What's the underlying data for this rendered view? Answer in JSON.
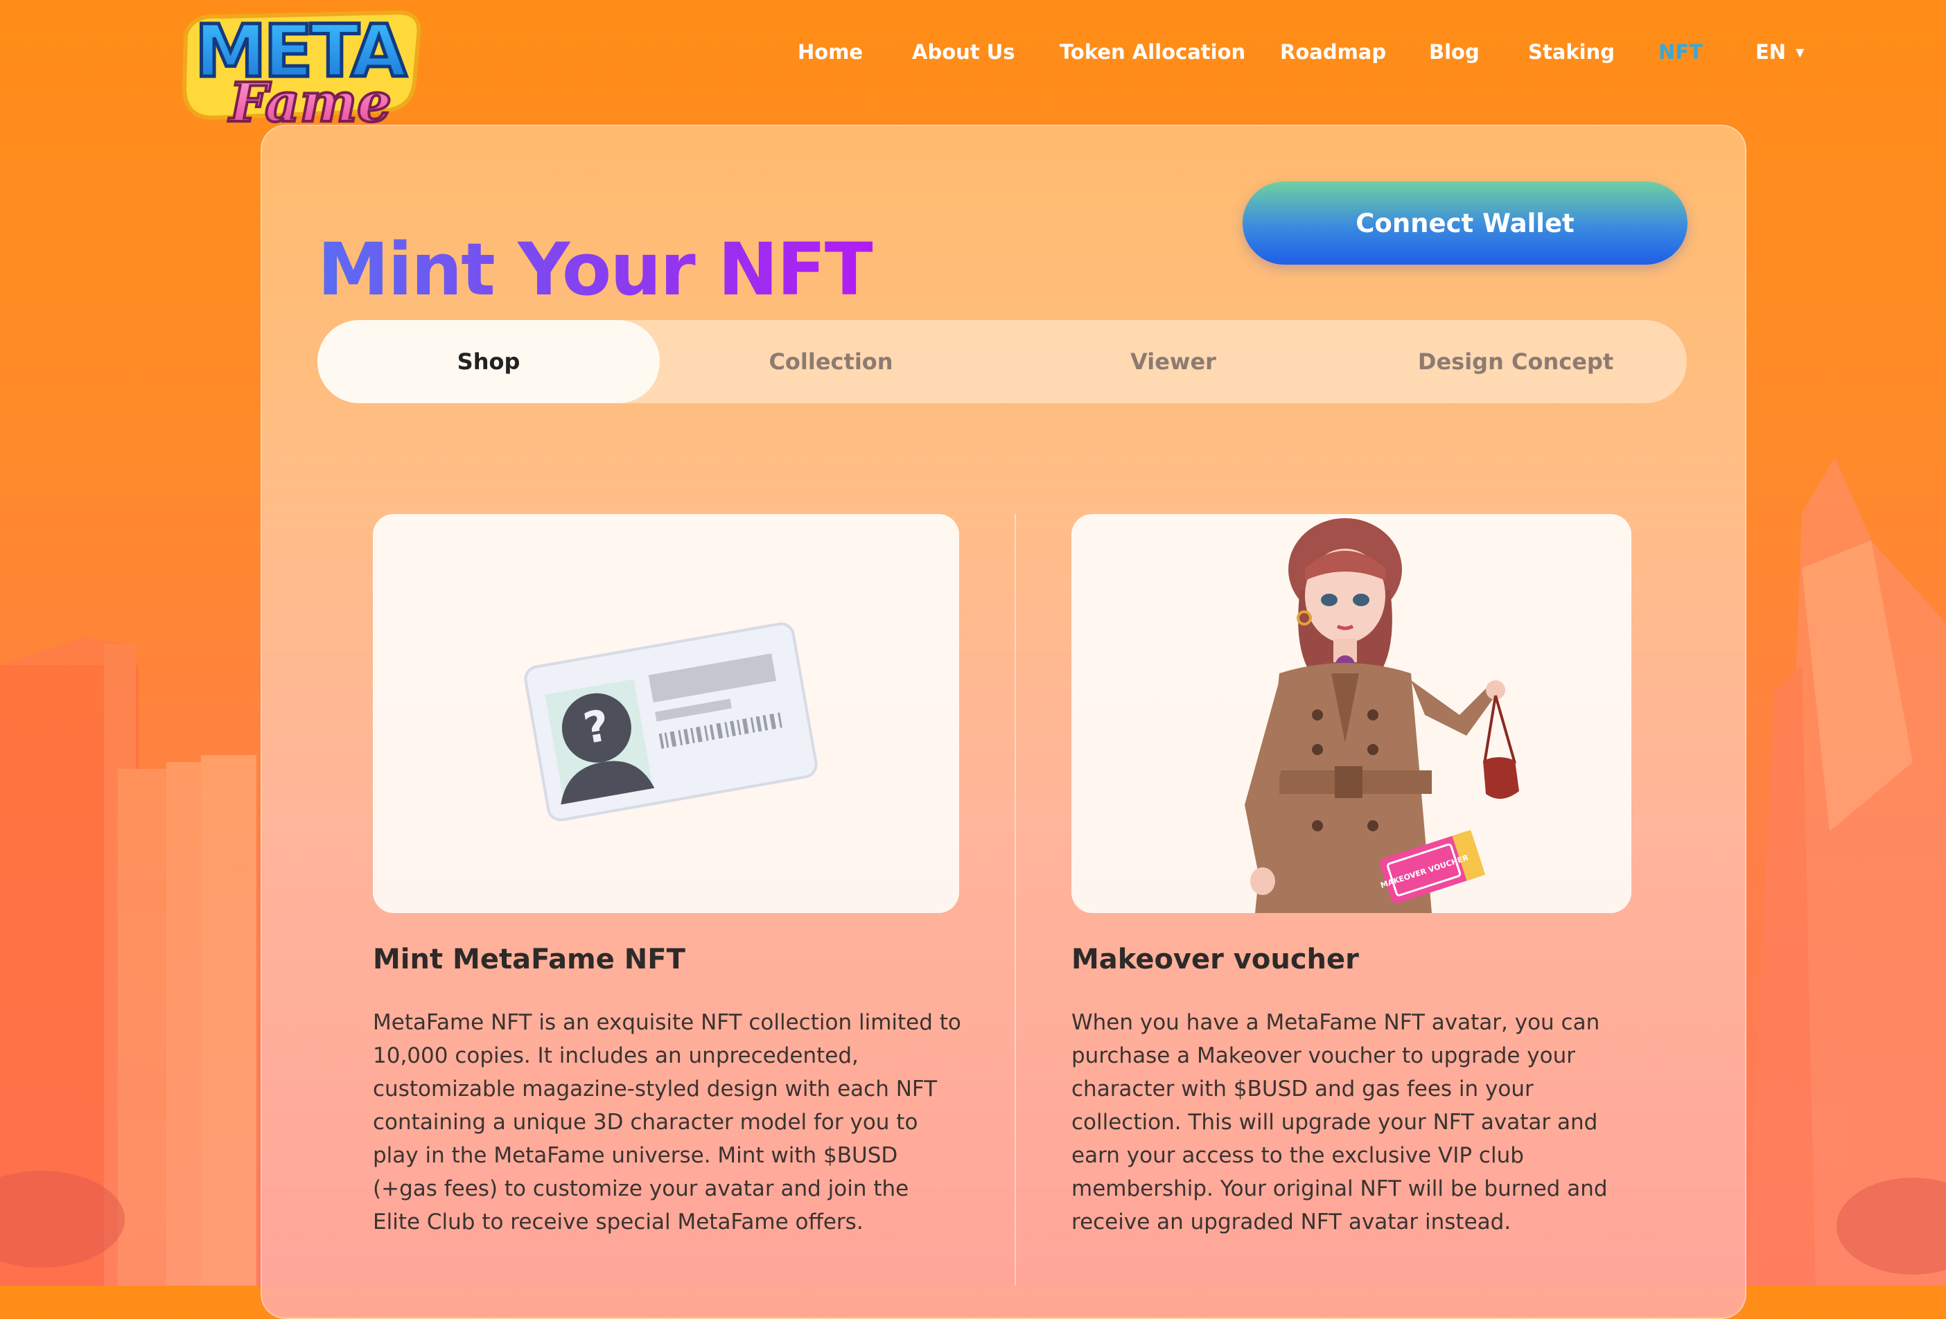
{
  "logo": {
    "line1": "META",
    "line2": "Fame"
  },
  "nav": {
    "items": [
      "Home",
      "About Us",
      "Token Allocation",
      "Roadmap",
      "Blog",
      "Staking",
      "NFT"
    ],
    "active": "NFT",
    "language": "EN"
  },
  "page": {
    "title": "Mint Your NFT",
    "connect_wallet_label": "Connect Wallet"
  },
  "tabs": {
    "items": [
      "Shop",
      "Collection",
      "Viewer",
      "Design Concept"
    ],
    "active": "Shop"
  },
  "products": [
    {
      "title": "Mint MetaFame NFT",
      "description": "MetaFame NFT is an exquisite NFT collection limited to 10,000 copies. It includes an unprecedented, customizable magazine-styled design with each NFT containing a unique 3D character model for you to play in the MetaFame universe. Mint with $BUSD (+gas fees) to customize your avatar and join the Elite Club to receive special MetaFame offers.",
      "image_icon": "mystery-id-card-icon"
    },
    {
      "title": "Makeover voucher",
      "description": "When you have a MetaFame NFT avatar, you can purchase a Makeover voucher to upgrade your character with $BUSD and gas fees in your collection. This will upgrade your NFT avatar and earn your access to the exclusive VIP club membership. Your original NFT will be burned and receive an upgraded NFT avatar instead.",
      "image_icon": "avatar-character-illustration",
      "voucher_text": "MAKEOVER VOUCHER"
    }
  ],
  "colors": {
    "nav_active": "#3aa7d6",
    "title_gradient_start": "#5b6cf2",
    "title_gradient_end": "#b21cf2",
    "button_gradient_start": "#6fd0a0",
    "button_gradient_end": "#1f5ee8"
  }
}
